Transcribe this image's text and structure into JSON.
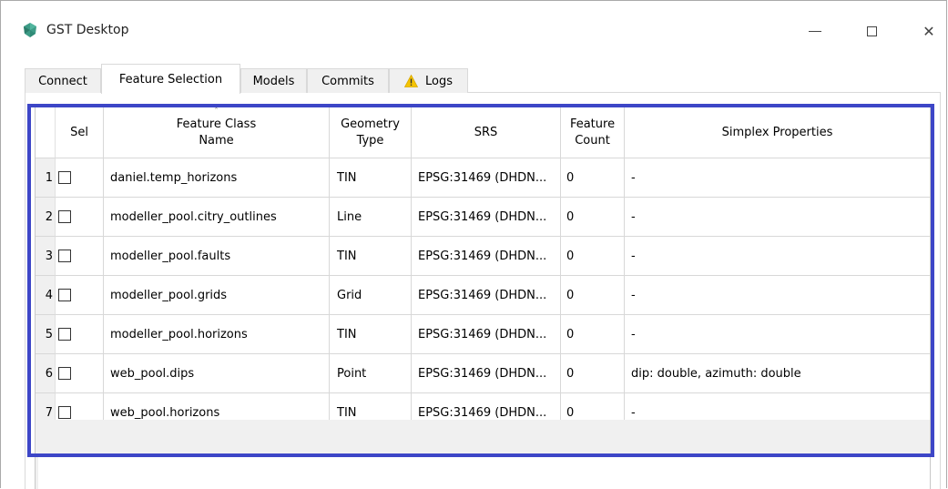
{
  "window": {
    "title": "GST Desktop",
    "icon": "gst-logo-icon",
    "controls": [
      "minimize-icon",
      "maximize-icon",
      "close-icon"
    ],
    "close_glyph": "✕"
  },
  "tabs": [
    {
      "label": "Connect",
      "active": false
    },
    {
      "label": "Feature Selection",
      "active": true
    },
    {
      "label": "Models",
      "active": false
    },
    {
      "label": "Commits",
      "active": false
    },
    {
      "label": "Logs",
      "active": false,
      "icon": "warning-icon"
    }
  ],
  "table": {
    "columns": [
      {
        "label": "Sel"
      },
      {
        "label": "Feature Class Name",
        "sort_icon": "ˆ"
      },
      {
        "label": "Geometry Type"
      },
      {
        "label": "SRS"
      },
      {
        "label": "Feature Count"
      },
      {
        "label": "Simplex Properties"
      }
    ],
    "rows": [
      {
        "index": "1",
        "name": "daniel.temp_horizons",
        "geometry": "TIN",
        "srs": "EPSG:31469 (DHDN...",
        "count": "0",
        "props": "-"
      },
      {
        "index": "2",
        "name": "modeller_pool.citry_outlines",
        "geometry": "Line",
        "srs": "EPSG:31469 (DHDN...",
        "count": "0",
        "props": "-"
      },
      {
        "index": "3",
        "name": "modeller_pool.faults",
        "geometry": "TIN",
        "srs": "EPSG:31469 (DHDN...",
        "count": "0",
        "props": "-"
      },
      {
        "index": "4",
        "name": "modeller_pool.grids",
        "geometry": "Grid",
        "srs": "EPSG:31469 (DHDN...",
        "count": "0",
        "props": "-"
      },
      {
        "index": "5",
        "name": "modeller_pool.horizons",
        "geometry": "TIN",
        "srs": "EPSG:31469 (DHDN...",
        "count": "0",
        "props": "-"
      },
      {
        "index": "6",
        "name": "web_pool.dips",
        "geometry": "Point",
        "srs": "EPSG:31469 (DHDN...",
        "count": "0",
        "props": "dip: double, azimuth: double"
      },
      {
        "index": "7",
        "name": "web_pool.horizons",
        "geometry": "TIN",
        "srs": "EPSG:31469 (DHDN...",
        "count": "0",
        "props": "-"
      }
    ]
  },
  "colors": {
    "highlight": "#3d46c7",
    "grid_background": "#f0f0f0",
    "warning": "#f5c400"
  }
}
